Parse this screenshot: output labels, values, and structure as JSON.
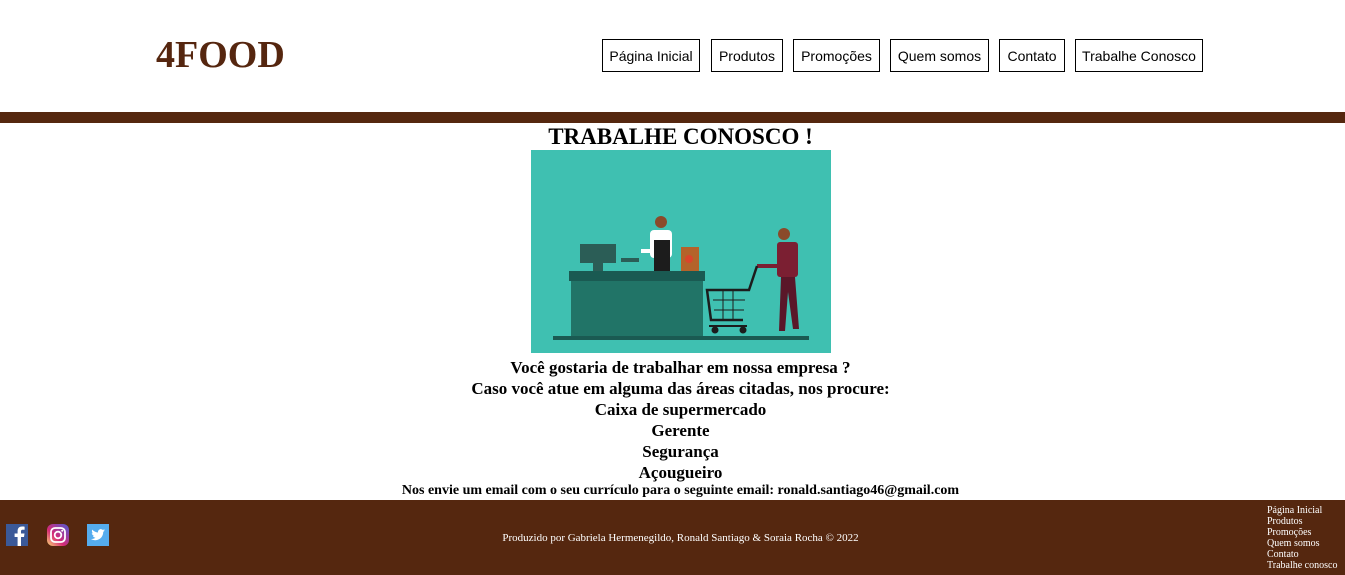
{
  "header": {
    "logo": "4FOOD",
    "nav": [
      "Página Inicial",
      "Produtos",
      "Promoções",
      "Quem somos",
      "Contato",
      "Trabalhe Conosco"
    ]
  },
  "main": {
    "title": "TRABALHE CONOSCO !",
    "illustration_icon": "supermarket-checkout-illustration",
    "lines": [
      "Você gostaria de trabalhar em nossa empresa ?",
      "Caso você atue em alguma das áreas citadas, nos procure:",
      "Caixa de supermercado",
      "Gerente",
      "Segurança",
      "Açougueiro"
    ],
    "email_note": "Nos envie um email com o seu currículo para o seguinte email: ronald.santiago46@gmail.com"
  },
  "footer": {
    "social": [
      "facebook-icon",
      "instagram-icon",
      "twitter-icon"
    ],
    "credit": "Produzido por Gabriela Hermenegildo, Ronald Santiago & Soraia Rocha © 2022",
    "links": [
      "Página Inicial",
      "Produtos",
      "Promoções",
      "Quem somos",
      "Contato",
      "Trabalhe conosco"
    ]
  },
  "colors": {
    "brand_brown": "#55270f",
    "illustration_bg": "#3fc0b1"
  }
}
